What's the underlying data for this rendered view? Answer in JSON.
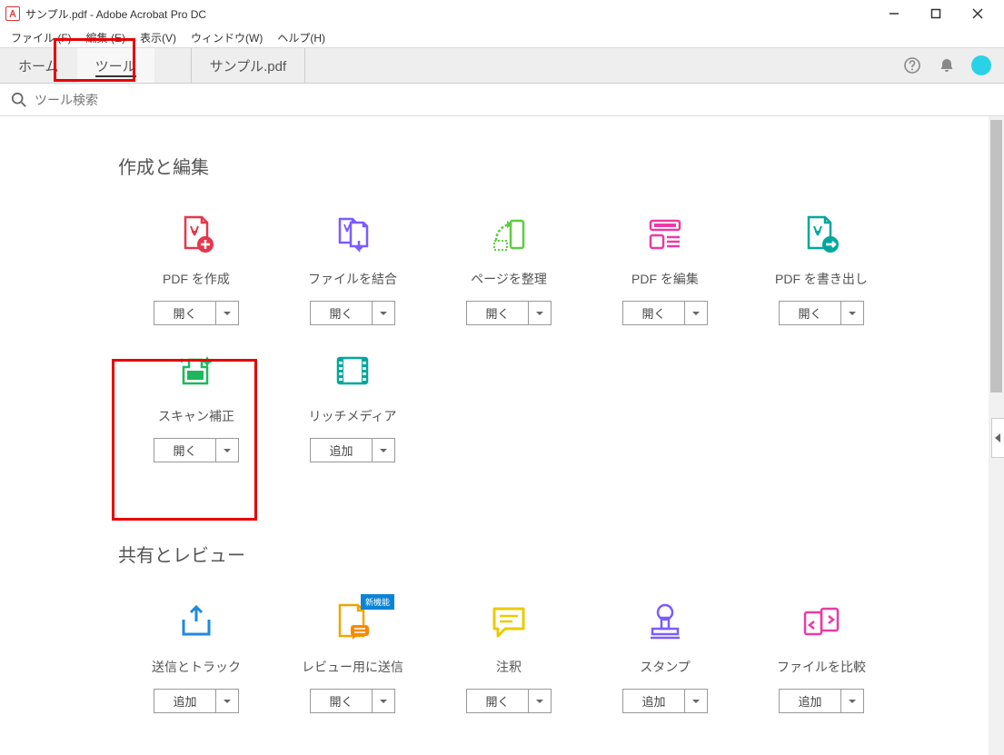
{
  "window": {
    "title": "サンプル.pdf - Adobe Acrobat Pro DC"
  },
  "menu": {
    "file": "ファイル (F)",
    "edit": "編集 (E)",
    "view": "表示(V)",
    "window": "ウィンドウ(W)",
    "help": "ヘルプ(H)"
  },
  "tabs": {
    "home": "ホーム",
    "tools": "ツール",
    "document": "サンプル.pdf"
  },
  "search": {
    "placeholder": "ツール検索"
  },
  "sections": {
    "create_edit": "作成と編集",
    "share_review": "共有とレビュー"
  },
  "buttons": {
    "open": "開く",
    "add": "追加"
  },
  "tools_create": [
    {
      "label": "PDF を作成",
      "btn": "open",
      "icon": "create-pdf"
    },
    {
      "label": "ファイルを結合",
      "btn": "open",
      "icon": "combine-files"
    },
    {
      "label": "ページを整理",
      "btn": "open",
      "icon": "organize-pages"
    },
    {
      "label": "PDF を編集",
      "btn": "open",
      "icon": "edit-pdf"
    },
    {
      "label": "PDF を書き出し",
      "btn": "open",
      "icon": "export-pdf"
    },
    {
      "label": "スキャン補正",
      "btn": "open",
      "icon": "enhance-scans"
    },
    {
      "label": "リッチメディア",
      "btn": "add",
      "icon": "rich-media"
    }
  ],
  "tools_share": [
    {
      "label": "送信とトラック",
      "btn": "add",
      "icon": "send-track"
    },
    {
      "label": "レビュー用に送信",
      "btn": "open",
      "icon": "send-review",
      "badge": "新機能"
    },
    {
      "label": "注釈",
      "btn": "open",
      "icon": "comment"
    },
    {
      "label": "スタンプ",
      "btn": "add",
      "icon": "stamp"
    },
    {
      "label": "ファイルを比較",
      "btn": "add",
      "icon": "compare"
    }
  ]
}
